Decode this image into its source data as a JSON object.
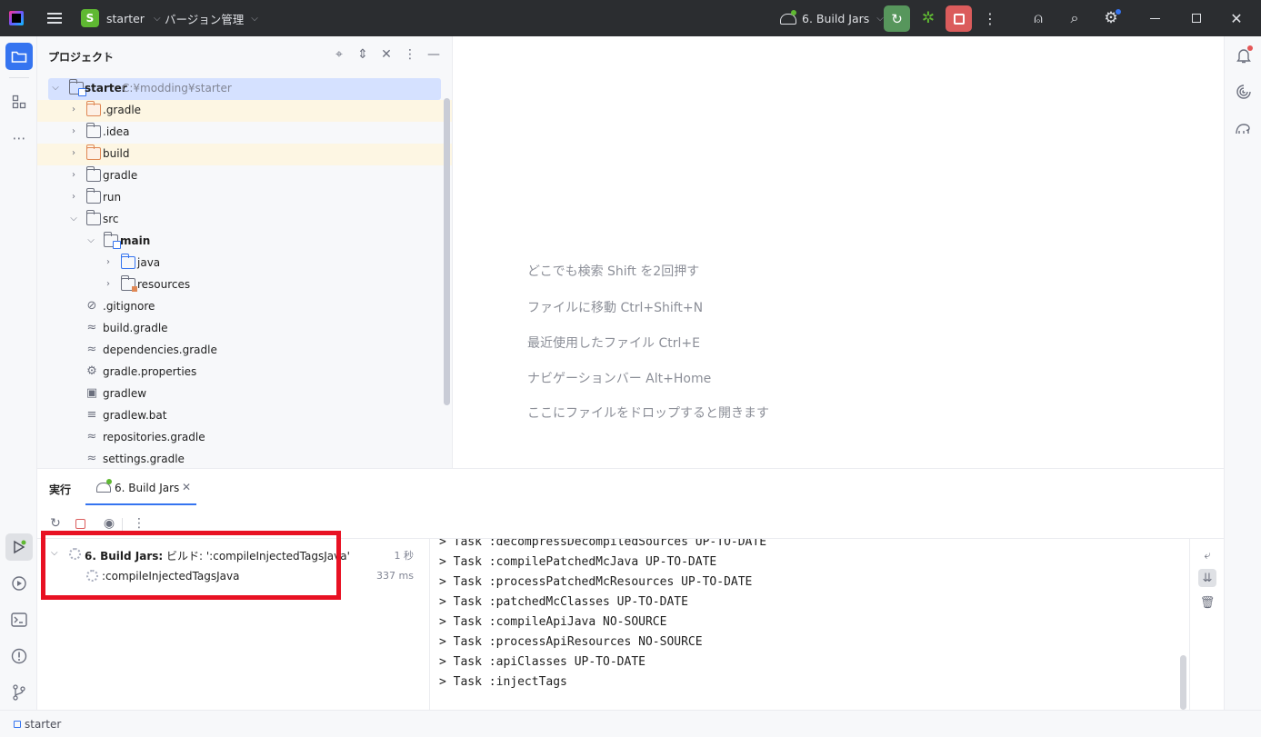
{
  "titlebar": {
    "project_badge": "S",
    "project_name": "starter",
    "vcs_menu": "バージョン管理",
    "run_config": "6. Build Jars"
  },
  "project_panel": {
    "title": "プロジェクト",
    "tree": [
      {
        "name": "starter",
        "path": "C:¥modding¥starter"
      },
      {
        "name": ".gradle"
      },
      {
        "name": ".idea"
      },
      {
        "name": "build"
      },
      {
        "name": "gradle"
      },
      {
        "name": "run"
      },
      {
        "name": "src"
      },
      {
        "name": "main"
      },
      {
        "name": "java"
      },
      {
        "name": "resources"
      },
      {
        "name": ".gitignore"
      },
      {
        "name": "build.gradle"
      },
      {
        "name": "dependencies.gradle"
      },
      {
        "name": "gradle.properties"
      },
      {
        "name": "gradlew"
      },
      {
        "name": "gradlew.bat"
      },
      {
        "name": "repositories.gradle"
      },
      {
        "name": "settings.gradle"
      }
    ]
  },
  "editor": {
    "hints": [
      "どこでも検索 Shift を2回押す",
      "ファイルに移動 Ctrl+Shift+N",
      "最近使用したファイル Ctrl+E",
      "ナビゲーションバー Alt+Home",
      "ここにファイルをドロップすると開きます"
    ]
  },
  "run_window": {
    "title": "実行",
    "tab_label": "6. Build Jars",
    "build_tree": [
      {
        "bold": "6. Build Jars:",
        "label": " ビルド: ':compileInjectedTagsJava'",
        "time": "1 秒"
      },
      {
        "label": ":compileInjectedTagsJava",
        "time": "337 ms"
      }
    ],
    "console": [
      "> Task :decompressDecompiledSources UP-TO-DATE",
      "> Task :compilePatchedMcJava UP-TO-DATE",
      "> Task :processPatchedMcResources UP-TO-DATE",
      "> Task :patchedMcClasses UP-TO-DATE",
      "> Task :compileApiJava NO-SOURCE",
      "> Task :processApiResources NO-SOURCE",
      "> Task :apiClasses UP-TO-DATE",
      "> Task :injectTags"
    ]
  },
  "statusbar": {
    "project": "starter"
  },
  "colors": {
    "accent": "#3574f0",
    "run_green": "#57965c",
    "stop_red": "#db5c5c",
    "highlight_box": "#e81123",
    "selection": "#d5e1ff",
    "excluded_bg": "#fdf6e3"
  },
  "icons": {
    "title_bar": [
      "app-logo-icon",
      "hamburger-menu-icon",
      "run-config-icon",
      "rerun-icon",
      "debug-icon",
      "stop-icon",
      "more-icon",
      "add-user-icon",
      "search-icon",
      "settings-icon"
    ],
    "left_strip": [
      "folder-icon",
      "structure-icon",
      "more-icon",
      "run-icon",
      "services-icon",
      "terminal-icon",
      "problems-icon",
      "git-icon"
    ],
    "right_strip": [
      "notifications-icon",
      "ai-assistant-icon",
      "gradle-icon"
    ]
  }
}
